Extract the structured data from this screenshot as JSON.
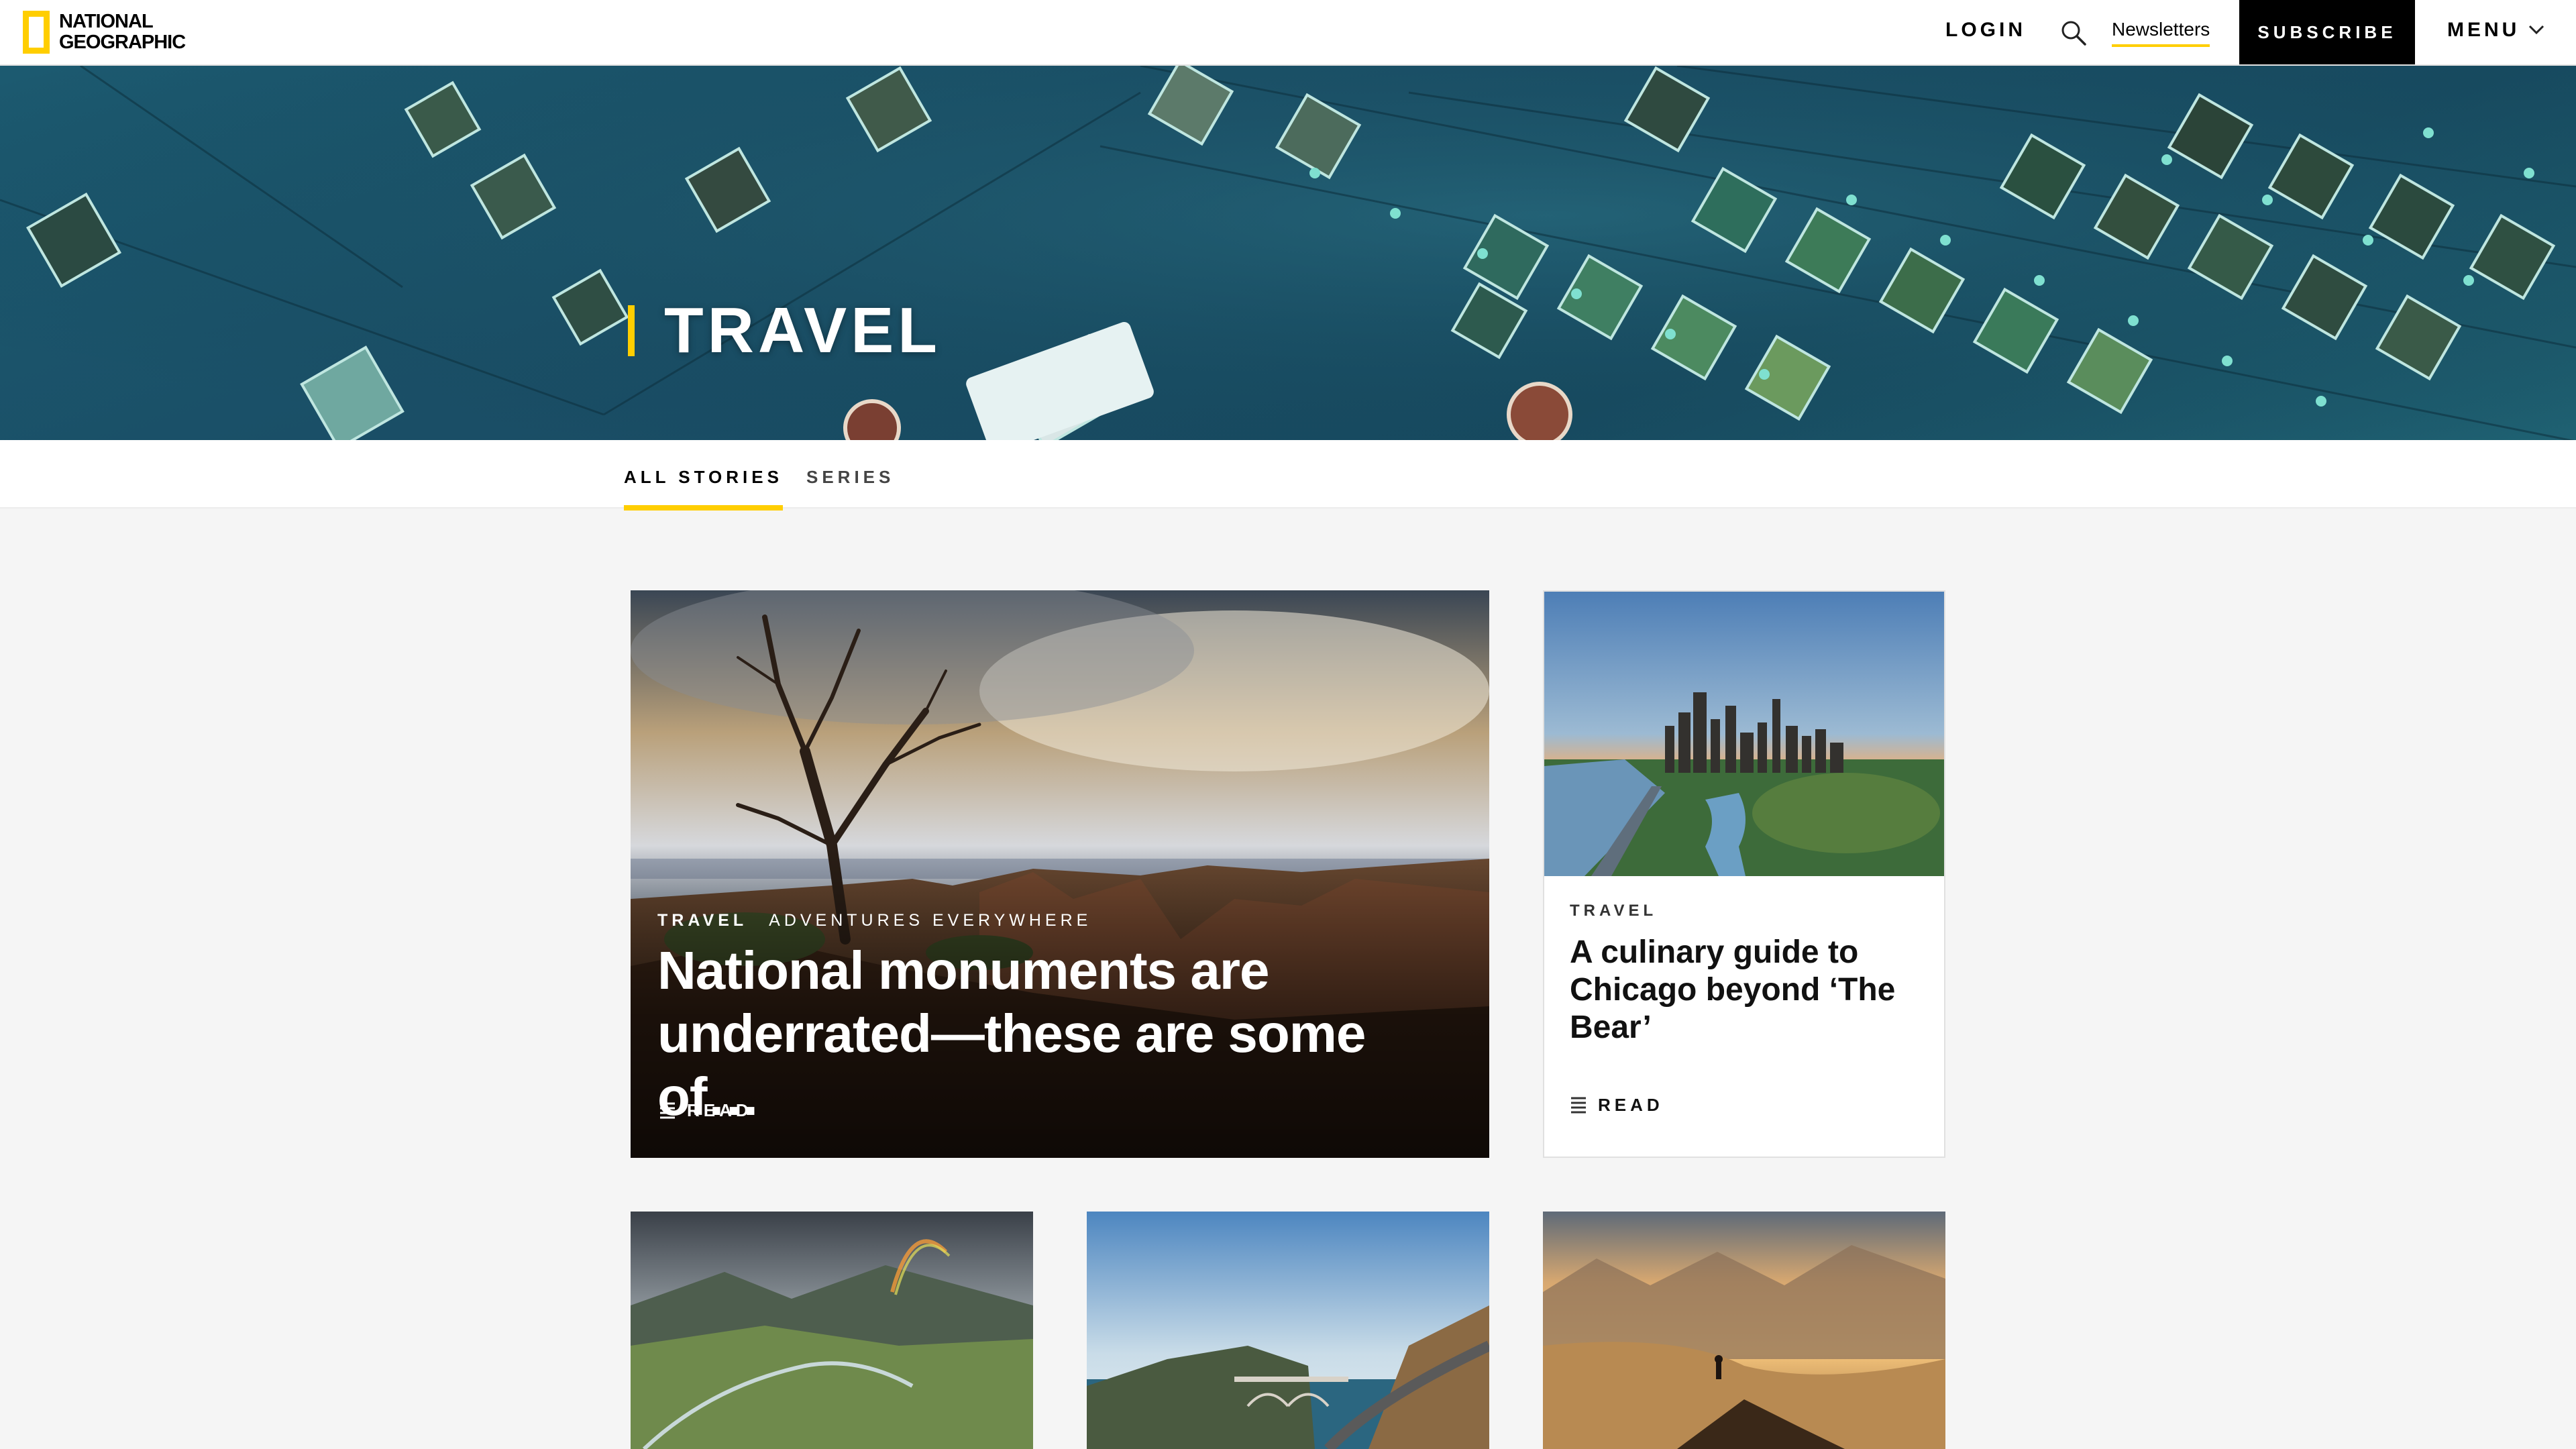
{
  "header": {
    "logo_line1": "NATIONAL",
    "logo_line2": "GEOGRAPHIC",
    "login_label": "LOGIN",
    "search_icon": "search-icon",
    "newsletters_label": "Newsletters",
    "subscribe_label": "SUBSCRIBE",
    "menu_label": "MENU",
    "menu_icon": "chevron-down-icon"
  },
  "hero": {
    "title": "TRAVEL"
  },
  "tabs": [
    {
      "label": "ALL STORIES",
      "active": true
    },
    {
      "label": "SERIES",
      "active": false
    }
  ],
  "feature_story": {
    "category": "TRAVEL",
    "series": "ADVENTURES EVERYWHERE",
    "headline": "National monuments are underrated—these are some of…",
    "read_label": "READ",
    "read_icon": "article-lines-icon"
  },
  "side_story": {
    "category": "TRAVEL",
    "headline": "A culinary guide to Chicago beyond ‘The Bear’",
    "read_label": "READ",
    "read_icon": "article-lines-icon"
  },
  "colors": {
    "accent_yellow": "#ffce00",
    "subscribe_bg": "#000000",
    "page_bg": "#f5f5f5"
  }
}
